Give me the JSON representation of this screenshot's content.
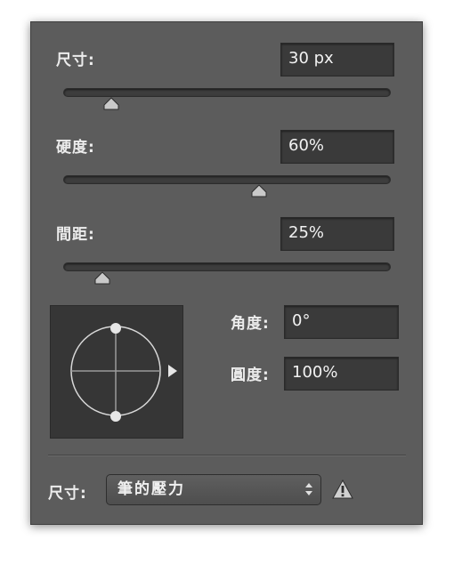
{
  "brush": {
    "size": {
      "label": "尺寸:",
      "value": "30 px",
      "slider_level": 0.12
    },
    "hardness": {
      "label": "硬度:",
      "value": "60%",
      "slider_level": 0.6
    },
    "spacing": {
      "label": "間距:",
      "value": "25%",
      "slider_level": 0.11
    }
  },
  "tip_shape": {
    "angle": {
      "label": "角度:",
      "value": "0°"
    },
    "roundness": {
      "label": "圓度:",
      "value": "100%"
    }
  },
  "size_control": {
    "label": "尺寸:",
    "selected": "筆的壓力",
    "warning_icon": "warning-triangle-icon"
  },
  "colors": {
    "panel": "#5c5c5c",
    "field": "#3a3a3a",
    "text": "#ececec"
  }
}
